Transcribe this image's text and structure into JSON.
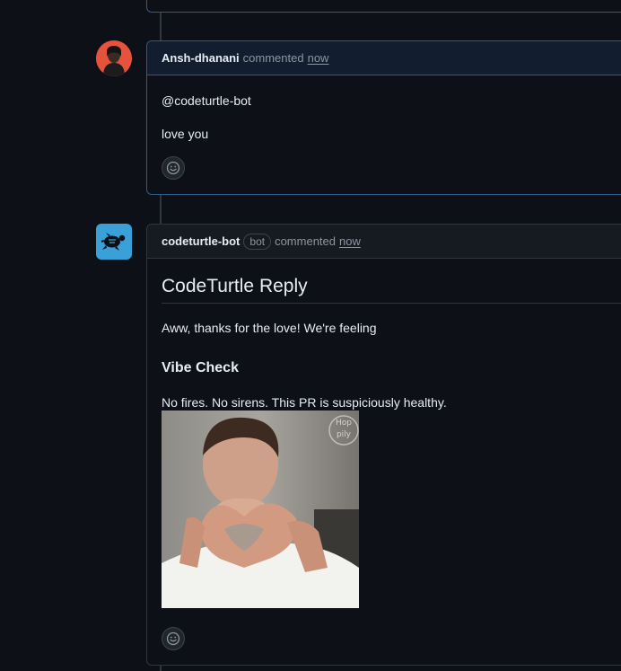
{
  "comments": [
    {
      "author": "Ansh-dhanani",
      "action": "commented",
      "timestamp": "now",
      "body": [
        "@codeturtle-bot",
        "love you"
      ],
      "avatar_icon": "user-avatar-icon"
    },
    {
      "author": "codeturtle-bot",
      "badge": "bot",
      "action": "commented",
      "timestamp": "now",
      "heading": "CodeTurtle Reply",
      "intro": "Aww, thanks for the love! We're feeling",
      "subheading": "Vibe Check",
      "text": "No fires. No sirens. This PR is suspiciously healthy.",
      "gif_watermark": "Hoppily",
      "avatar_icon": "turtle-icon"
    }
  ],
  "reaction_icon": "smiley-icon",
  "colors": {
    "background": "#0d1117",
    "header_bg": "#161b22",
    "border": "#30363d",
    "highlight_border": "#2f5a8c",
    "bot_avatar": "#3aa0d8",
    "user_avatar": "#e5533d"
  }
}
